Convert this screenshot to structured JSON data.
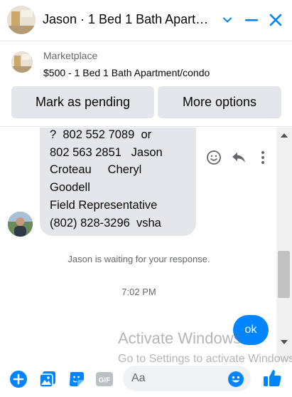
{
  "header": {
    "title": "Jason · 1 Bed 1 Bath Apartment/condo",
    "buttons": [
      "minimize",
      "minimize",
      "close"
    ]
  },
  "listing": {
    "kind": "Marketplace",
    "title": "$500 - 1 Bed 1 Bath Apartment/condo",
    "mark_pending_label": "Mark as pending",
    "more_options_label": "More options"
  },
  "conversation": {
    "incoming_message": "?  802 552 7089  or\n802 563 2851   Jason\nCroteau     Cheryl\nGoodell\nField Representative\n(802) 828-3296  vsha",
    "waiting_notice": "Jason is waiting for your response.",
    "timestamp": "7:02 PM",
    "outgoing_message": "ok"
  },
  "composer": {
    "placeholder": "Aa",
    "icons": [
      "plus-icon",
      "photo-icon",
      "sticker-icon",
      "gif-icon",
      "emoji-icon",
      "thumbs-up-icon"
    ]
  },
  "watermark": {
    "line1": "Activate Windows",
    "line2": "Go to Settings to activate Windows."
  },
  "colors": {
    "accent": "#0084ff",
    "bubble_in": "#e4e6eb",
    "muted_text": "#65676b"
  }
}
